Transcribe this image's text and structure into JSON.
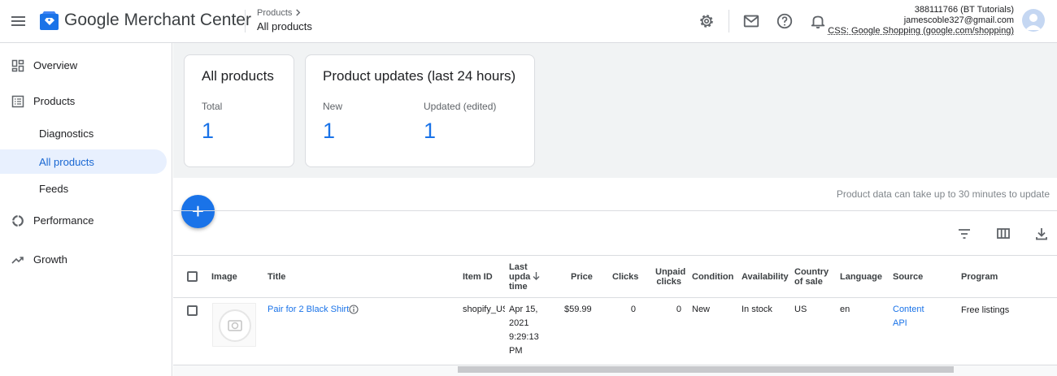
{
  "header": {
    "brand": "Google Merchant Center",
    "breadcrumb_parent": "Products",
    "breadcrumb_current": "All products",
    "account_line1": "388111766 (BT Tutorials)",
    "account_line2": "jamescoble327@gmail.com",
    "account_line3": "CSS: Google Shopping (google.com/shopping)"
  },
  "sidebar": {
    "overview": "Overview",
    "products": "Products",
    "diagnostics": "Diagnostics",
    "all_products": "All products",
    "feeds": "Feeds",
    "performance": "Performance",
    "growth": "Growth"
  },
  "cards": {
    "all_products_title": "All products",
    "total_label": "Total",
    "total_value": "1",
    "updates_title": "Product updates (last 24 hours)",
    "new_label": "New",
    "new_value": "1",
    "updated_label": "Updated (edited)",
    "updated_value": "1"
  },
  "note": "Product data can take up to 30 minutes to update",
  "table": {
    "headers": {
      "image": "Image",
      "title": "Title",
      "item_id": "Item ID",
      "last_update": [
        "Last",
        "upda",
        "time"
      ],
      "price": "Price",
      "clicks": "Clicks",
      "unpaid_clicks": [
        "Unpaid",
        "clicks"
      ],
      "condition": "Condition",
      "availability": "Availability",
      "country": [
        "Country",
        "of sale"
      ],
      "language": "Language",
      "source": "Source",
      "program": "Program"
    },
    "row": {
      "title": "Pair for 2 Black Shirt",
      "item_id": "shopify_US",
      "date": [
        "Apr 15,",
        "2021",
        "9:29:13",
        "PM"
      ],
      "price": "$59.99",
      "clicks": "0",
      "unpaid_clicks": "0",
      "condition": "New",
      "availability": "In stock",
      "country": "US",
      "language": "en",
      "source": [
        "Content",
        "API"
      ],
      "program": "Free listings"
    }
  },
  "colors": {
    "accent": "#1a73e8",
    "active_bg": "#e8f0fe",
    "divider": "#dadce0"
  }
}
